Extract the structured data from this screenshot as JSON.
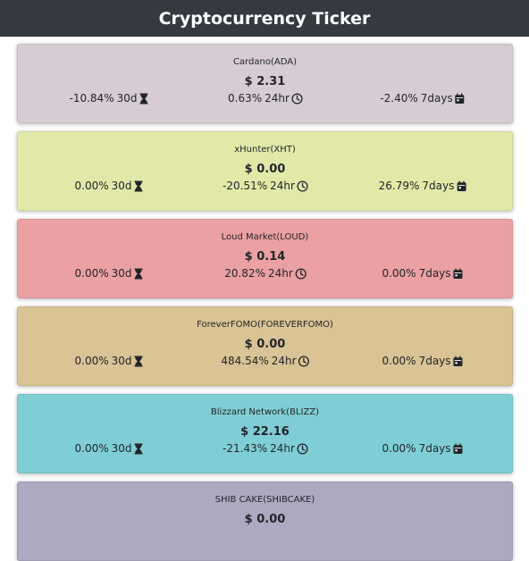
{
  "header": {
    "title": "Cryptocurrency Ticker"
  },
  "coins": [
    {
      "name": "Cardano(ADA)",
      "price": "$ 2.31",
      "change_30d": "-10.84%",
      "label_30d": "30d",
      "change_24h": "0.63%",
      "label_24h": "24hr",
      "change_7d": "-2.40%",
      "label_7d": "7days",
      "color": "#d7ccd4"
    },
    {
      "name": "xHunter(XHT)",
      "price": "$ 0.00",
      "change_30d": "0.00%",
      "label_30d": "30d",
      "change_24h": "-20.51%",
      "label_24h": "24hr",
      "change_7d": "26.79%",
      "label_7d": "7days",
      "color": "#e2e9a8"
    },
    {
      "name": "Loud Market(LOUD)",
      "price": "$ 0.14",
      "change_30d": "0.00%",
      "label_30d": "30d",
      "change_24h": "20.82%",
      "label_24h": "24hr",
      "change_7d": "0.00%",
      "label_7d": "7days",
      "color": "#eba0a3"
    },
    {
      "name": "ForeverFOMO(FOREVERFOMO)",
      "price": "$ 0.00",
      "change_30d": "0.00%",
      "label_30d": "30d",
      "change_24h": "484.54%",
      "label_24h": "24hr",
      "change_7d": "0.00%",
      "label_7d": "7days",
      "color": "#dac394"
    },
    {
      "name": "Blizzard Network(BLIZZ)",
      "price": "$ 22.16",
      "change_30d": "0.00%",
      "label_30d": "30d",
      "change_24h": "-21.43%",
      "label_24h": "24hr",
      "change_7d": "0.00%",
      "label_7d": "7days",
      "color": "#80ced5"
    },
    {
      "name": "SHIB CAKE(SHIBCAKE)",
      "price": "$ 0.00",
      "color": "#aea8c1"
    }
  ],
  "icons": {
    "change_30d": "hourglass-icon",
    "change_24h": "clock-icon",
    "change_7d": "calendar-icon"
  }
}
